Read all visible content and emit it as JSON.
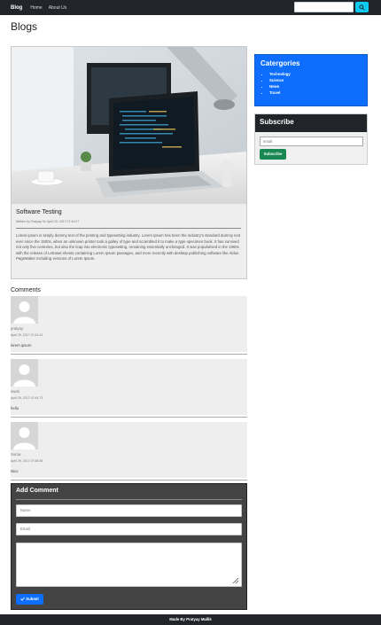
{
  "navbar": {
    "brand": "Blog",
    "links": [
      "Home",
      "About Us"
    ],
    "search_icon": "search-icon"
  },
  "page": {
    "title": "Blogs"
  },
  "post": {
    "title": "Software Testing",
    "meta": "Written by Pratyay On April 29, 2017 07:44:07",
    "body": "Lorem ipsum is simply dummy text of the printing and typesetting industry. Lorem ipsum has been the industry's standard dummy text ever since the 1500s, when an unknown printer took a galley of type and scrambled it to make a type specimen book. It has survived not only five centuries, but also the leap into electronic typesetting, remaining essentially unchanged. It was popularised in the 1960s with the release of Letraset sheets containing Lorem Ipsum passages, and more recently with desktop publishing software like Aldus PageMaker including versions of Lorem Ipsum."
  },
  "categories": {
    "title": "Catergories",
    "items": [
      "Technology",
      "Science",
      "News",
      "Travel"
    ]
  },
  "subscribe": {
    "title": "Subscribe",
    "placeholder": "email",
    "button": "Subscribe"
  },
  "comments": {
    "heading": "Comments",
    "items": [
      {
        "name": "pratyay",
        "date": "April 29, 2017 07:41:10",
        "text": "lorem ipsum"
      },
      {
        "name": "swati",
        "date": "April 29, 2017 07:44:73",
        "text": "hello"
      },
      {
        "name": "Suma",
        "date": "April 29, 2017 07:48:36",
        "text": "Nice"
      }
    ]
  },
  "add_comment": {
    "title": "Add Comment",
    "name_placeholder": "Name",
    "email_placeholder": "Email",
    "submit": "Submit"
  },
  "footer": {
    "text": "Made By Pratyay Mallik"
  },
  "colors": {
    "navbar": "#212529",
    "primary": "#0d6efd",
    "success": "#198754",
    "info": "#0dcaf0",
    "panel": "#444444"
  }
}
